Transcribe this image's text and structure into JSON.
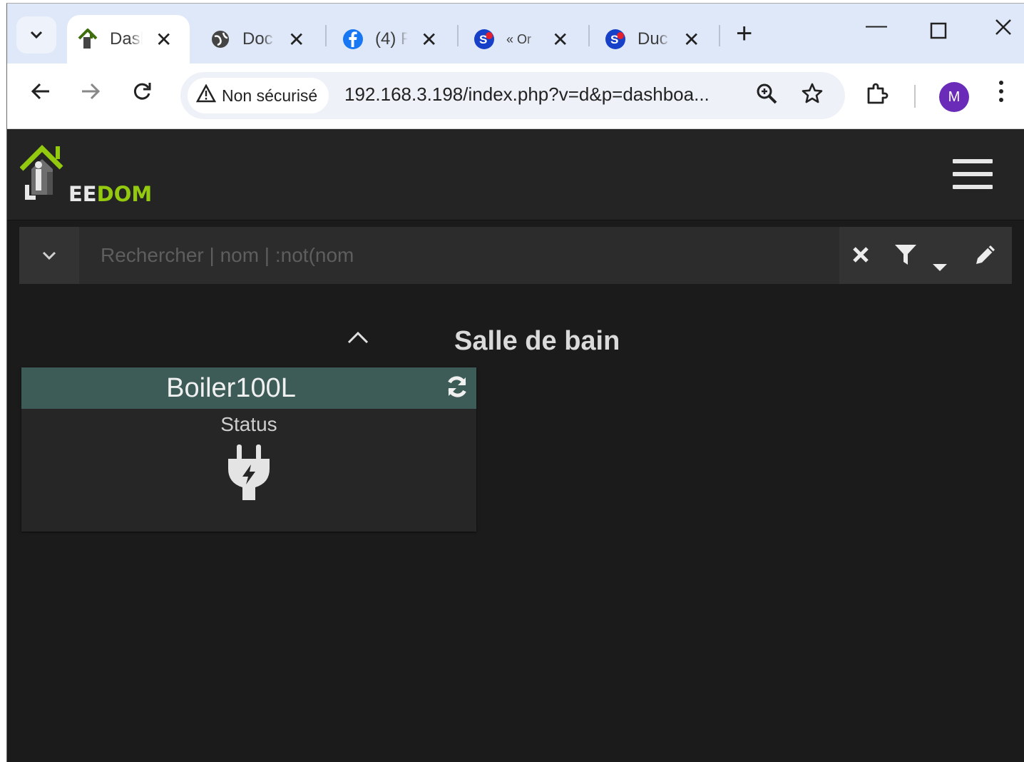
{
  "browser": {
    "tabs": [
      {
        "title": "Dasl",
        "favicon": "jeedom-favicon",
        "active": true
      },
      {
        "title": "Doc",
        "favicon": "globe-icon"
      },
      {
        "title": "(4) F",
        "favicon": "facebook-icon"
      },
      {
        "title": "« Or",
        "favicon": "s-logo-icon"
      },
      {
        "title": "Duc",
        "favicon": "s-logo-icon"
      }
    ],
    "security_label": "Non sécurisé",
    "url": "192.168.3.198/index.php?v=d&p=dashboa...",
    "profile_initial": "M"
  },
  "app": {
    "logo_text_1": "EE",
    "logo_text_2": "DOM",
    "search_placeholder": "Rechercher | nom | :not(nom",
    "object": {
      "title": "Salle de bain",
      "widget": {
        "name": "Boiler100L",
        "command_label": "Status",
        "command_icon": "plug-icon",
        "header_color": "#3d5c57"
      }
    }
  },
  "colors": {
    "accent": "#93c90f",
    "background": "#1b1b1b"
  }
}
